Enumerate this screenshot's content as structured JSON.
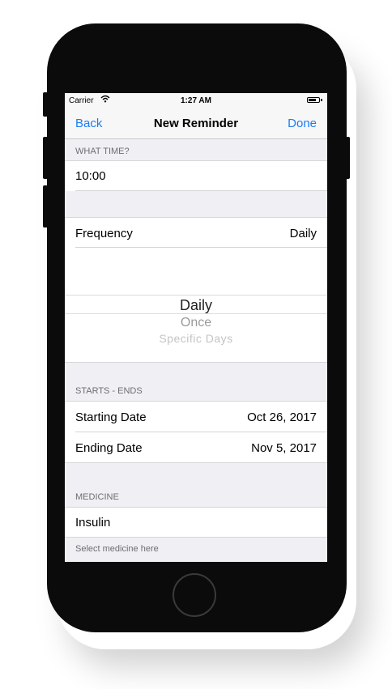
{
  "status_bar": {
    "carrier": "Carrier",
    "time": "1:27 AM",
    "battery_level": 0.75
  },
  "nav": {
    "back_label": "Back",
    "title": "New Reminder",
    "done_label": "Done"
  },
  "what_time": {
    "header": "WHAT TIME?",
    "value": "10:00"
  },
  "frequency": {
    "label": "Frequency",
    "value": "Daily",
    "picker_options": [
      "Daily",
      "Once",
      "Specific Days"
    ],
    "selected_index": 0
  },
  "starts_ends": {
    "header": "STARTS - ENDS",
    "starting_label": "Starting Date",
    "starting_value": "Oct 26, 2017",
    "ending_label": "Ending Date",
    "ending_value": "Nov 5, 2017"
  },
  "medicine": {
    "header": "MEDICINE",
    "value": "Insulin",
    "footer": "Select medicine here"
  },
  "colors": {
    "accent": "#1e7cf2",
    "group_background": "#efeff4",
    "device": "#0b0b0b"
  }
}
